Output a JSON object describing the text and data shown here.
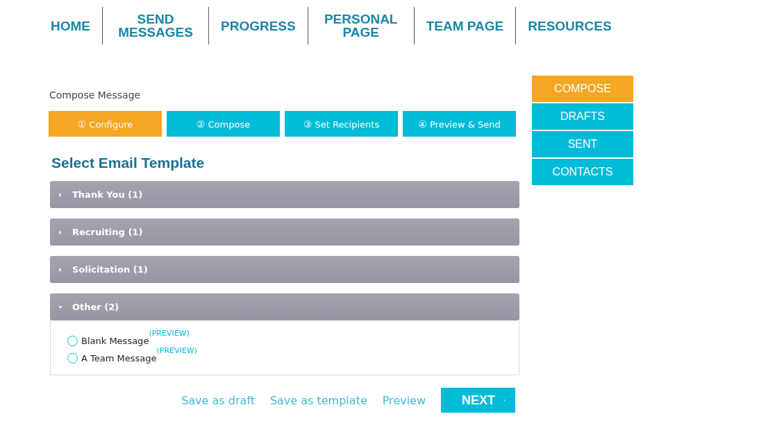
{
  "nav": [
    {
      "label": "HOME"
    },
    {
      "label": "SEND MESSAGES"
    },
    {
      "label": "PROGRESS"
    },
    {
      "label": "PERSONAL PAGE"
    },
    {
      "label": "TEAM PAGE"
    },
    {
      "label": "RESOURCES"
    }
  ],
  "breadcrumb": "Compose Message",
  "steps": [
    {
      "number": "①",
      "label": "Configure",
      "selected": true
    },
    {
      "number": "②",
      "label": "Compose",
      "selected": false
    },
    {
      "number": "③",
      "label": "Set Recipients",
      "selected": false
    },
    {
      "number": "④",
      "label": "Preview & Send",
      "selected": false
    }
  ],
  "heading": "Select Email Template",
  "groups": [
    {
      "title": "Thank You (1)",
      "expanded": false
    },
    {
      "title": "Recruiting (1)",
      "expanded": false
    },
    {
      "title": "Solicitation (1)",
      "expanded": false
    },
    {
      "title": "Other (2)",
      "expanded": true,
      "options": [
        {
          "label": "Blank Message",
          "link": "(PREVIEW)",
          "selected": false
        },
        {
          "label": "A Team Message",
          "link": "(PREVIEW)",
          "selected": false
        }
      ]
    }
  ],
  "actions": {
    "links": [
      "Save as draft",
      "Save as template",
      "Preview"
    ],
    "next": "NEXT"
  },
  "side_menu": [
    {
      "label": "COMPOSE",
      "selected": true
    },
    {
      "label": "DRAFTS",
      "selected": false
    },
    {
      "label": "SENT",
      "selected": false
    },
    {
      "label": "CONTACTS",
      "selected": false
    }
  ]
}
